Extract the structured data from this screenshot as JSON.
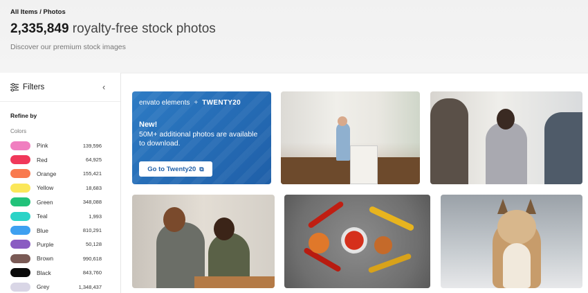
{
  "breadcrumb": {
    "root": "All Items",
    "sep": "/",
    "current": "Photos"
  },
  "header": {
    "count": "2,335,849",
    "title_rest": " royalty-free stock photos",
    "subtitle": "Discover our premium stock images"
  },
  "sidebar": {
    "filters_label": "Filters",
    "refine_label": "Refine by",
    "colors_label": "Colors",
    "colors": [
      {
        "name": "Pink",
        "count": "139,596",
        "hex": "#f07fc0"
      },
      {
        "name": "Red",
        "count": "64,925",
        "hex": "#f0385a"
      },
      {
        "name": "Orange",
        "count": "155,421",
        "hex": "#f97a4f"
      },
      {
        "name": "Yellow",
        "count": "18,683",
        "hex": "#fbe75a"
      },
      {
        "name": "Green",
        "count": "348,088",
        "hex": "#22c27a"
      },
      {
        "name": "Teal",
        "count": "1,993",
        "hex": "#2bd3c7"
      },
      {
        "name": "Blue",
        "count": "810,291",
        "hex": "#3ea0f0"
      },
      {
        "name": "Purple",
        "count": "50,128",
        "hex": "#8a5cc2"
      },
      {
        "name": "Brown",
        "count": "990,618",
        "hex": "#7a5a55"
      },
      {
        "name": "Black",
        "count": "843,760",
        "hex": "#0a0a0a"
      },
      {
        "name": "Grey",
        "count": "1,348,437",
        "hex": "#d9d6e6"
      }
    ]
  },
  "promo": {
    "brand_left": "envato elements",
    "brand_plus": "+",
    "brand_right": "TWENTY20",
    "new_label": "New!",
    "text": "50M+ additional photos are available to download.",
    "button_label": "Go to Twenty20",
    "button_icon": "external-link-icon"
  }
}
